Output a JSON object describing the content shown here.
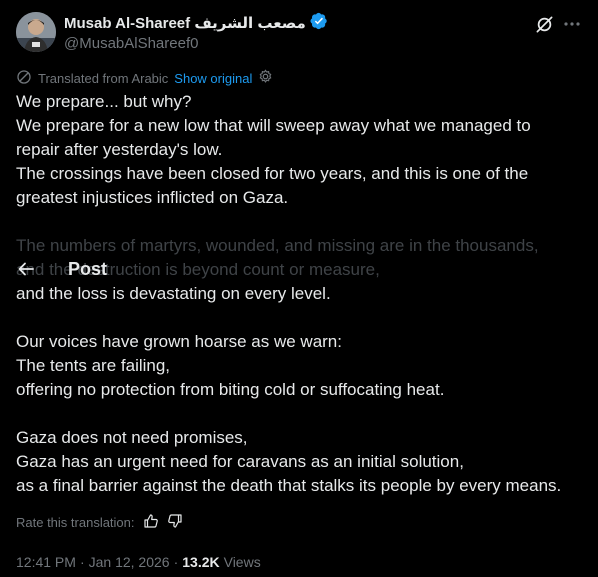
{
  "author": {
    "display_name": "Musab Al-Shareef مصعب الشريف",
    "handle": "@MusabAlShareef0",
    "verified_icon": "verified-badge-icon",
    "avatar": "avatar"
  },
  "header_actions": {
    "grok_icon": "grok-icon",
    "more_icon": "more-icon"
  },
  "translation": {
    "translated_label": "Translated from Arabic",
    "show_original_label": "Show original",
    "translate_icon": "translate-icon",
    "settings_icon": "gear-icon"
  },
  "overlay": {
    "back_icon": "back-arrow-icon",
    "title": "Post"
  },
  "body": {
    "p1": [
      "We prepare... but why?",
      "We prepare for a new low that will sweep away what we managed to",
      "repair after yesterday's low.",
      "The crossings have been closed for two years, and this is one of the",
      "greatest injustices inflicted on Gaza."
    ],
    "p2": [
      "The numbers of martyrs, wounded, and missing are in the thousands,",
      "and the destruction is beyond count or measure,",
      "and the loss is devastating on every level."
    ],
    "p3": [
      "Our voices have grown hoarse as we warn:",
      "The tents are failing,",
      "offering no protection from biting cold or suffocating heat."
    ],
    "p4": [
      "Gaza does not need promises,",
      "Gaza has an urgent need for caravans as an initial solution,",
      "as a final barrier against the death that stalks its people by every means."
    ]
  },
  "rate": {
    "label": "Rate this translation:",
    "thumbs_up_icon": "thumbs-up-icon",
    "thumbs_down_icon": "thumbs-down-icon"
  },
  "meta": {
    "time": "12:41 PM",
    "separator": "·",
    "date": "Jan 12, 2026",
    "views_count": "13.2K",
    "views_label": "Views"
  },
  "colors": {
    "background": "#000000",
    "text_primary": "#e7e9ea",
    "text_secondary": "#71767b",
    "accent": "#1d9bf0"
  }
}
